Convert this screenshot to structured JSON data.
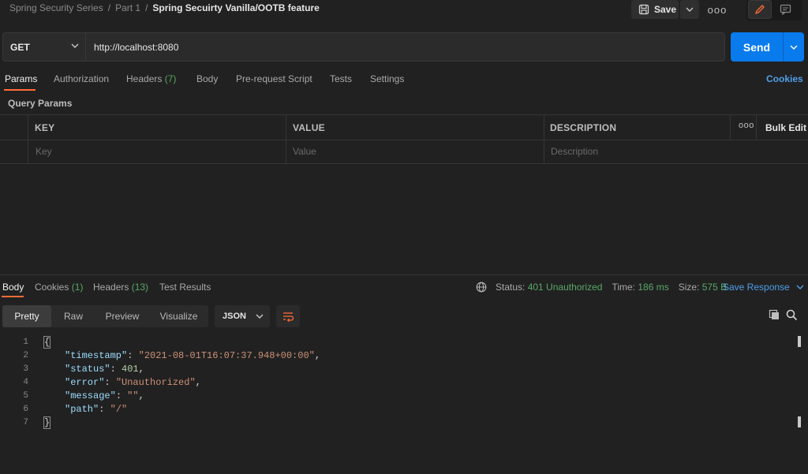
{
  "breadcrumb": {
    "part1": "Spring Security Series",
    "part2": "Part 1",
    "current": "Spring Secuirty Vanilla/OOTB feature",
    "separator": "/"
  },
  "toolbar": {
    "save_label": "Save",
    "more_glyph": "ooo"
  },
  "request": {
    "method": "GET",
    "url": "http://localhost:8080",
    "send_label": "Send"
  },
  "request_tabs": {
    "params": "Params",
    "authorization": "Authorization",
    "headers": "Headers",
    "headers_count": "(7)",
    "body": "Body",
    "pre_request": "Pre-request Script",
    "tests": "Tests",
    "settings": "Settings",
    "cookies": "Cookies"
  },
  "query_params": {
    "title": "Query Params",
    "columns": [
      "KEY",
      "VALUE",
      "DESCRIPTION"
    ],
    "placeholders": [
      "Key",
      "Value",
      "Description"
    ],
    "more": "ooo",
    "bulk_edit": "Bulk Edit"
  },
  "response_tabs": {
    "body": "Body",
    "cookies": "Cookies",
    "cookies_count": "(1)",
    "headers": "Headers",
    "headers_count": "(13)",
    "test_results": "Test Results"
  },
  "response_status": {
    "status_label": "Status:",
    "status_value": "401 Unauthorized",
    "time_label": "Time:",
    "time_value": "186 ms",
    "size_label": "Size:",
    "size_value": "575 B",
    "save_response": "Save Response"
  },
  "view_modes": {
    "pretty": "Pretty",
    "raw": "Raw",
    "preview": "Preview",
    "visualize": "Visualize",
    "format": "JSON"
  },
  "response_body": {
    "line_numbers": [
      "1",
      "2",
      "3",
      "4",
      "5",
      "6",
      "7"
    ],
    "open_brace": "{",
    "close_brace": "}",
    "timestamp_key": "\"timestamp\"",
    "timestamp_value": "\"2021-08-01T16:07:37.948+00:00\"",
    "status_key": "\"status\"",
    "status_value": "401",
    "error_key": "\"error\"",
    "error_value": "\"Unauthorized\"",
    "message_key": "\"message\"",
    "message_value": "\"\"",
    "path_key": "\"path\"",
    "path_value": "\"/\""
  },
  "colors": {
    "accent_orange": "#ff6c37",
    "send_blue": "#097bed",
    "link_blue": "#4e9fe8",
    "status_green": "#59a869"
  },
  "icons": [
    "save-icon",
    "chevron-down-icon",
    "more-icon",
    "pencil-icon",
    "comment-icon",
    "globe-icon",
    "wrap-lines-icon",
    "copy-icon",
    "search-icon"
  ]
}
